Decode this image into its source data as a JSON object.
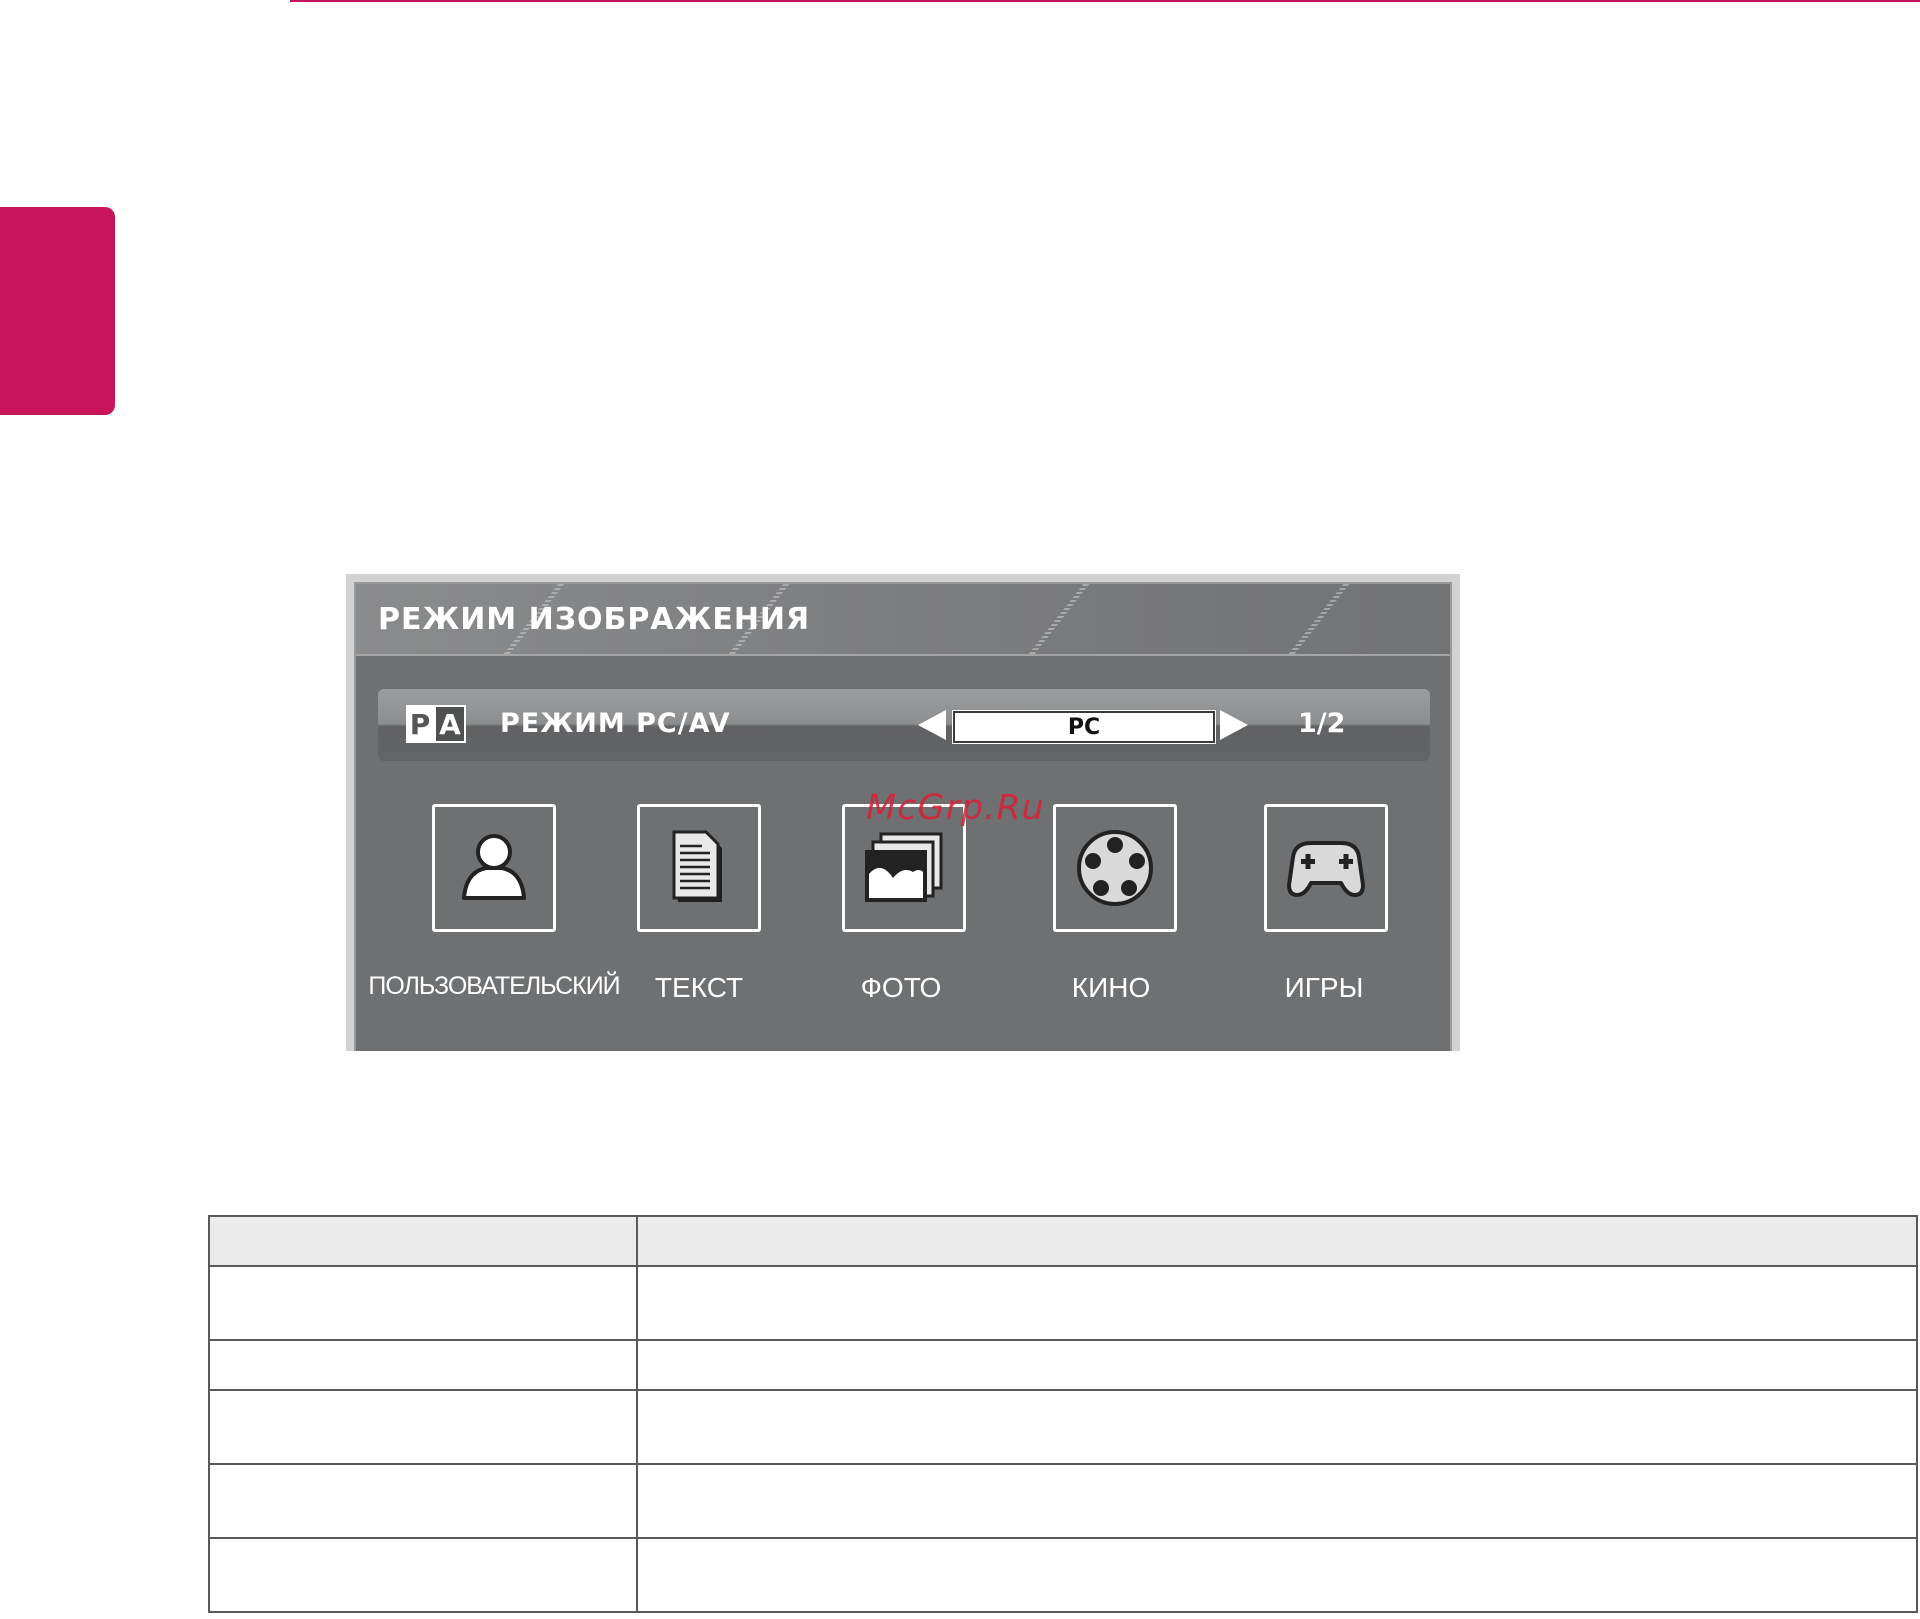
{
  "osd": {
    "title": "РЕЖИМ ИЗОБРАЖЕНИЯ",
    "mode_row": {
      "icon_letters": [
        "P",
        "A"
      ],
      "label": "РЕЖИМ PC/AV",
      "value": "PC",
      "page": "1/2"
    },
    "modes": [
      {
        "label": "ПОЛЬЗОВАТЕЛЬСКИЙ",
        "icon": "user-icon"
      },
      {
        "label": "ТЕКСТ",
        "icon": "document-icon"
      },
      {
        "label": "ФОТО",
        "icon": "photo-icon"
      },
      {
        "label": "КИНО",
        "icon": "film-reel-icon"
      },
      {
        "label": "ИГРЫ",
        "icon": "gamepad-icon"
      }
    ]
  },
  "watermark": "McGrp.Ru",
  "colors": {
    "accent": "#c8145a",
    "osd_background": "#6f7072",
    "watermark": "#d81f36"
  }
}
